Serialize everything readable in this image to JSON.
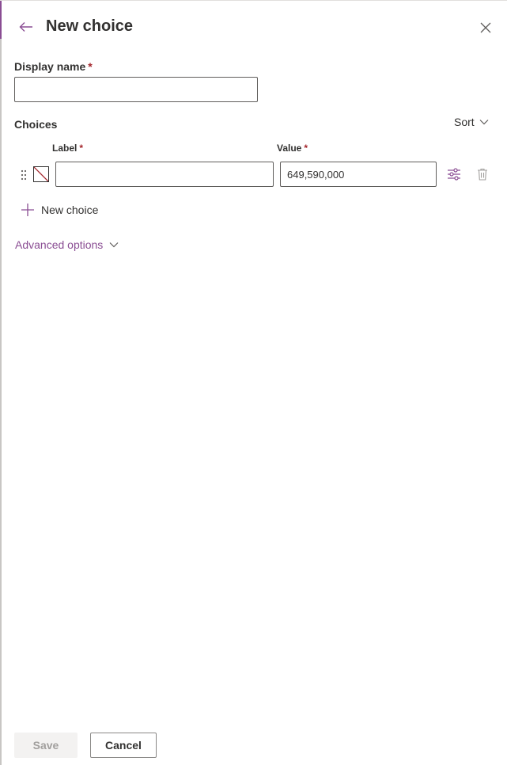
{
  "header": {
    "title": "New choice"
  },
  "display_name": {
    "label": "Display name",
    "required_mark": "*",
    "value": ""
  },
  "choices": {
    "section_label": "Choices",
    "sort_label": "Sort",
    "columns": {
      "label_header": "Label",
      "value_header": "Value",
      "required_mark": "*"
    },
    "rows": [
      {
        "label": "",
        "value": "649,590,000",
        "color": "none"
      }
    ],
    "new_choice_label": "New choice"
  },
  "advanced_options_label": "Advanced options",
  "footer": {
    "save_label": "Save",
    "cancel_label": "Cancel"
  },
  "colors": {
    "accent": "#8a4d93",
    "required": "#a4262c",
    "text": "#323130"
  },
  "icons": {
    "back": "arrow-left-icon",
    "close": "close-icon",
    "sort": "chevron-down-icon",
    "drag": "drag-handle-icon",
    "settings": "sliders-icon",
    "delete": "trash-icon",
    "add": "plus-icon",
    "advanced": "chevron-down-icon"
  }
}
